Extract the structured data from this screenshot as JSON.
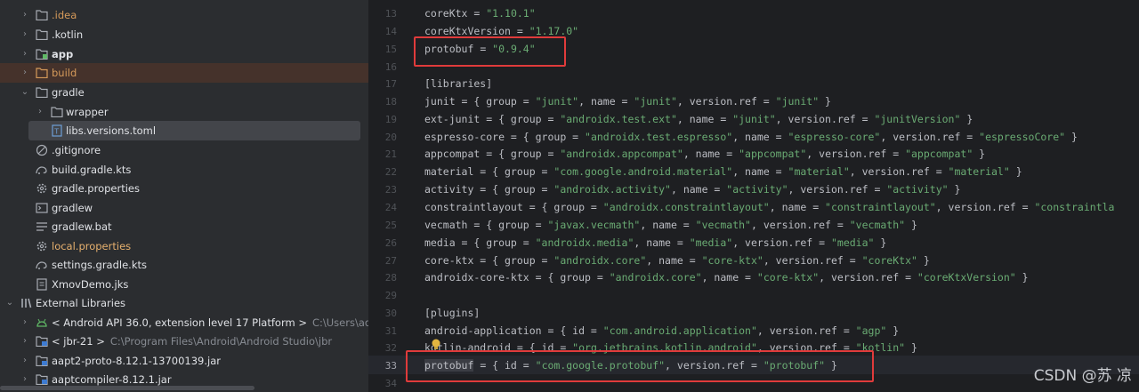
{
  "tree": {
    "items": [
      {
        "label": ".idea"
      },
      {
        "label": ".kotlin"
      },
      {
        "label": "app"
      },
      {
        "label": "build"
      },
      {
        "label": "gradle"
      },
      {
        "label": "wrapper"
      },
      {
        "label": "libs.versions.toml"
      },
      {
        "label": ".gitignore"
      },
      {
        "label": "build.gradle.kts"
      },
      {
        "label": "gradle.properties"
      },
      {
        "label": "gradlew"
      },
      {
        "label": "gradlew.bat"
      },
      {
        "label": "local.properties"
      },
      {
        "label": "settings.gradle.kts"
      },
      {
        "label": "XmovDemo.jks"
      },
      {
        "label": "External Libraries"
      },
      {
        "label": "< Android API 36.0, extension level 17 Platform >",
        "path": "C:\\Users\\admin\\Ap"
      },
      {
        "label": "< jbr-21 >",
        "path": "C:\\Program Files\\Android\\Android Studio\\jbr"
      },
      {
        "label": "aapt2-proto-8.12.1-13700139.jar"
      },
      {
        "label": "aaptcompiler-8.12.1.jar"
      }
    ]
  },
  "editor": {
    "line_numbers": [
      "13",
      "14",
      "15",
      "16",
      "17",
      "18",
      "19",
      "20",
      "21",
      "22",
      "23",
      "24",
      "25",
      "26",
      "27",
      "28",
      "29",
      "30",
      "31",
      "32",
      "33",
      "34"
    ],
    "lines": {
      "l13": {
        "key": "coreKtx",
        "val": "\"1.10.1\""
      },
      "l14": {
        "key": "coreKtxVersion",
        "val": "\"1.17.0\""
      },
      "l15": {
        "key": "protobuf",
        "val": "\"0.9.4\""
      },
      "l17": {
        "section": "[libraries]"
      },
      "l18": {
        "text": "junit = { group = \"junit\", name = \"junit\", version.ref = \"junit\" }"
      },
      "l19": {
        "text": "ext-junit = { group = \"androidx.test.ext\", name = \"junit\", version.ref = \"junitVersion\" }"
      },
      "l20": {
        "text": "espresso-core = { group = \"androidx.test.espresso\", name = \"espresso-core\", version.ref = \"espressoCore\" }"
      },
      "l21": {
        "text": "appcompat = { group = \"androidx.appcompat\", name = \"appcompat\", version.ref = \"appcompat\" }"
      },
      "l22": {
        "text": "material = { group = \"com.google.android.material\", name = \"material\", version.ref = \"material\" }"
      },
      "l23": {
        "text": "activity = { group = \"androidx.activity\", name = \"activity\", version.ref = \"activity\" }"
      },
      "l24": {
        "text": "constraintlayout = { group = \"androidx.constraintlayout\", name = \"constraintlayout\", version.ref = \"constraintla"
      },
      "l25": {
        "text": "vecmath = { group = \"javax.vecmath\", name = \"vecmath\", version.ref = \"vecmath\" }"
      },
      "l26": {
        "text": "media = { group = \"androidx.media\", name = \"media\", version.ref = \"media\" }"
      },
      "l27": {
        "text": "core-ktx = { group = \"androidx.core\", name = \"core-ktx\", version.ref = \"coreKtx\" }"
      },
      "l28": {
        "text": "androidx-core-ktx = { group = \"androidx.core\", name = \"core-ktx\", version.ref = \"coreKtxVersion\" }"
      },
      "l30": {
        "section": "[plugins]"
      },
      "l31": {
        "text": "android-application = { id = \"com.android.application\", version.ref = \"agp\" }"
      },
      "l32": {
        "text": "kotlin-android = { id = \"org.jetbrains.kotlin.android\", version.ref = \"kotlin\" }"
      },
      "l33": {
        "ident": "protobuf",
        "rest": " = { id = \"com.google.protobuf\", version.ref = \"protobuf\" }"
      }
    }
  },
  "watermark": "CSDN @苏 凉",
  "colors": {
    "highlight_box": "#e03b3b",
    "string": "#6aab73",
    "sidebar_bg": "#2b2d30",
    "editor_bg": "#1e1f22"
  }
}
